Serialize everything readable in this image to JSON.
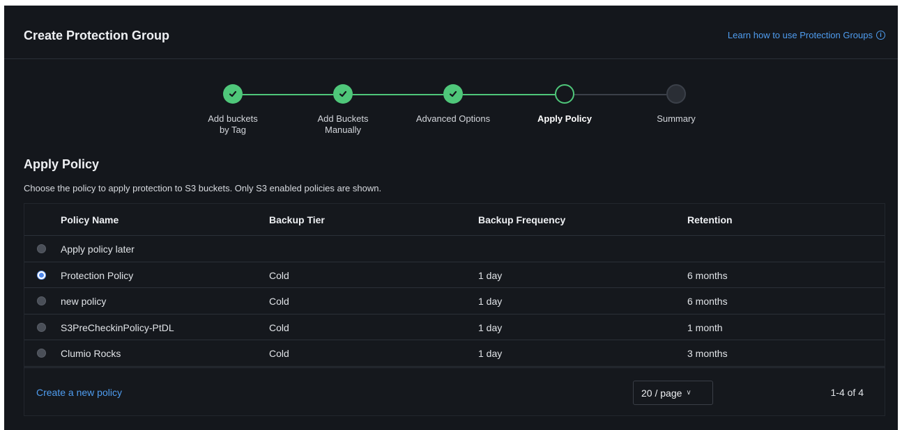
{
  "header": {
    "title": "Create Protection Group",
    "learn_link": "Learn how to use Protection Groups"
  },
  "stepper": {
    "steps": [
      {
        "label": "Add buckets by Tag",
        "state": "done"
      },
      {
        "label": "Add Buckets Manually",
        "state": "done"
      },
      {
        "label": "Advanced Options",
        "state": "done"
      },
      {
        "label": "Apply Policy",
        "state": "current"
      },
      {
        "label": "Summary",
        "state": "todo"
      }
    ]
  },
  "section": {
    "title": "Apply Policy",
    "description": "Choose the policy to apply protection to S3 buckets. Only S3 enabled policies are shown."
  },
  "table": {
    "columns": [
      "Policy Name",
      "Backup Tier",
      "Backup Frequency",
      "Retention"
    ],
    "rows": [
      {
        "name": "Apply policy later",
        "tier": "",
        "frequency": "",
        "retention": "",
        "selected": false
      },
      {
        "name": "Protection Policy",
        "tier": "Cold",
        "frequency": "1 day",
        "retention": "6 months",
        "selected": true
      },
      {
        "name": "new policy",
        "tier": "Cold",
        "frequency": "1 day",
        "retention": "6 months",
        "selected": false
      },
      {
        "name": "S3PreCheckinPolicy-PtDL",
        "tier": "Cold",
        "frequency": "1 day",
        "retention": "1 month",
        "selected": false
      },
      {
        "name": "Clumio Rocks",
        "tier": "Cold",
        "frequency": "1 day",
        "retention": "3 months",
        "selected": false
      }
    ]
  },
  "footer": {
    "create_link": "Create a new policy",
    "page_size": "20 / page",
    "range": "1-4 of 4"
  },
  "colors": {
    "accent_green": "#4fc77a",
    "link_blue": "#4f9df0",
    "background": "#14171c"
  }
}
